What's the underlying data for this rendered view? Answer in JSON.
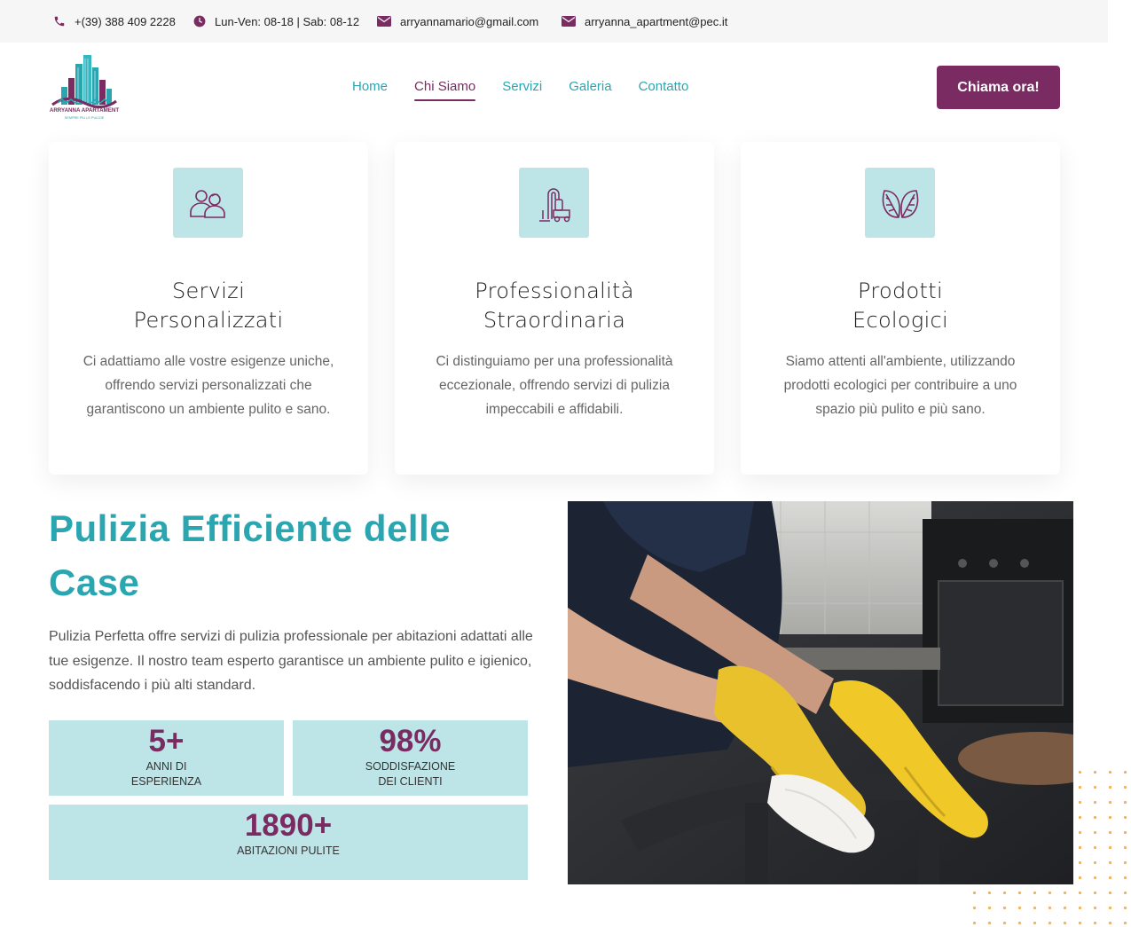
{
  "topbar": {
    "phone": "+(39) 388 409 2228",
    "hours": "Lun-Ven: 08-18 | Sab: 08-12",
    "email": "arryannamario@gmail.com",
    "pec": "arryanna_apartment@pec.it"
  },
  "logo": {
    "name": "ARRYANNA APARTAMENT",
    "tagline": "SEMPRE PIU LE PULIZIE"
  },
  "nav": {
    "items": [
      {
        "label": "Home",
        "active": false
      },
      {
        "label": "Chi Siamo",
        "active": true
      },
      {
        "label": "Servizi",
        "active": false
      },
      {
        "label": "Galeria",
        "active": false
      },
      {
        "label": "Contatto",
        "active": false
      }
    ],
    "cta_label": "Chiama ora!"
  },
  "features": [
    {
      "icon": "people-icon",
      "title_line1": "Servizi",
      "title_line2": "Personalizzati",
      "text": "Ci adattiamo alle vostre esigenze uniche, offrendo servizi personalizzati che garantiscono un ambiente pulito e sano."
    },
    {
      "icon": "vacuum-icon",
      "title_line1": "Professionalità",
      "title_line2": "Straordinaria",
      "text": "Ci distinguiamo per una professionalità eccezionale, offrendo servizi di pulizia impeccabili e affidabili."
    },
    {
      "icon": "leaf-icon",
      "title_line1": "Prodotti",
      "title_line2": "Ecologici",
      "text": "Siamo attenti all'ambiente, utilizzando prodotti ecologici per contribuire a uno spazio più pulito e più sano."
    }
  ],
  "section": {
    "title": "Pulizia Efficiente delle Case",
    "text": "Pulizia Perfetta offre servizi di pulizia professionale per abitazioni adattati alle tue esigenze. Il nostro team esperto garantisce un ambiente pulito e igienico, soddisfacendo i più alti standard."
  },
  "stats": [
    {
      "value": "5+",
      "label_line1": "ANNI DI",
      "label_line2": "ESPERIENZA"
    },
    {
      "value": "98%",
      "label_line1": "SODDISFAZIONE",
      "label_line2": "DEI CLIENTI"
    },
    {
      "value": "1890+",
      "label_line1": "ABITAZIONI PULITE",
      "label_line2": ""
    }
  ],
  "colors": {
    "accent_teal": "#2aa6b1",
    "brand_purple": "#7a2c62",
    "card_icon_bg": "#bde5e8",
    "dots": "#f2b35a"
  }
}
